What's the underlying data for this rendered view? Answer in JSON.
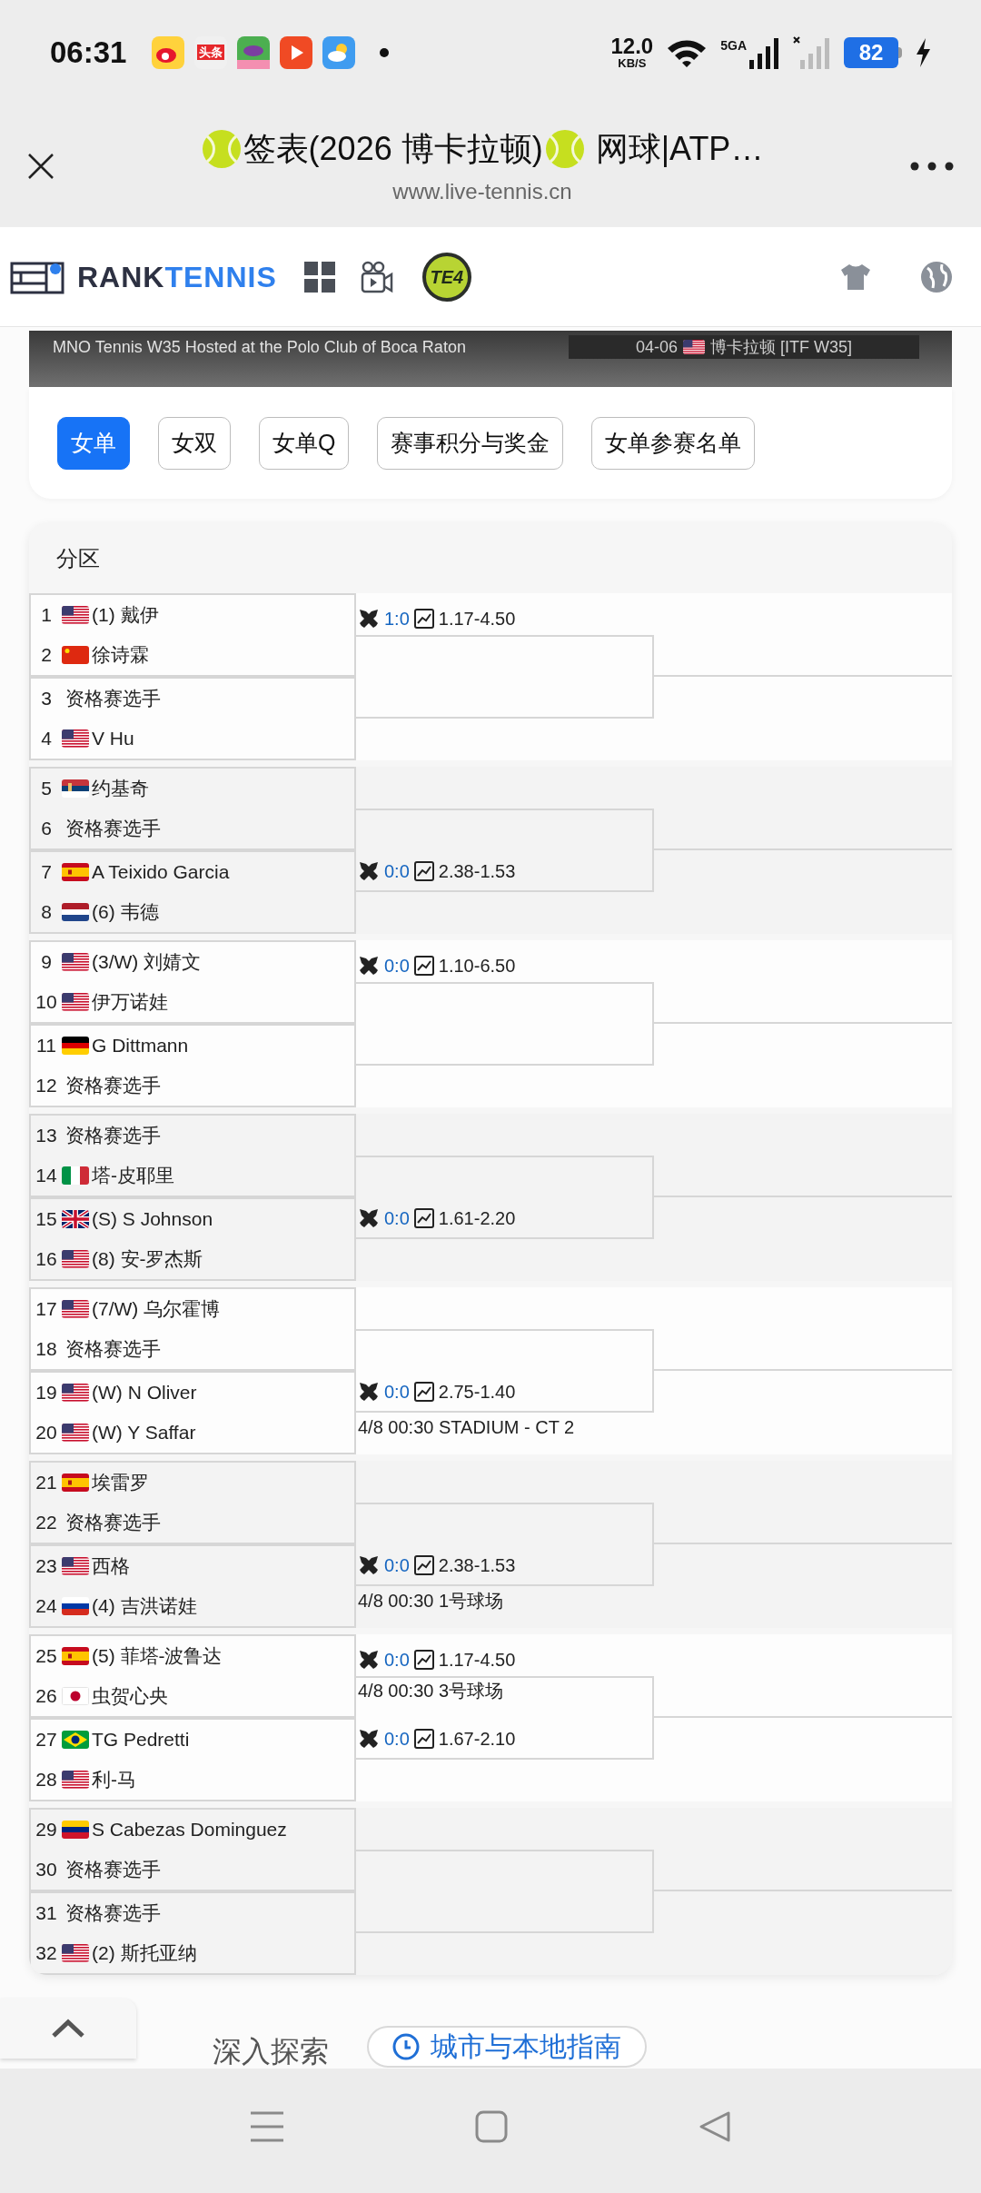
{
  "status_bar": {
    "time": "06:31",
    "notification_label": "头条",
    "net_speed": "12.0",
    "net_unit": "KB/S",
    "network": "5GA",
    "battery": "82"
  },
  "browser": {
    "title_parts": [
      "签表(2026 博卡拉顿)",
      "网球|ATP…"
    ],
    "url": "www.live-tennis.cn"
  },
  "site_header": {
    "logo_dark": "RANK",
    "logo_blue": "TENNIS",
    "badge": "TE4"
  },
  "banner": {
    "event": "MNO Tennis W35 Hosted at the Polo Club of Boca Raton",
    "date": "04-06",
    "flag": {
      "kind": "us"
    },
    "location": "博卡拉顿 [ITF W35]"
  },
  "tabs": [
    {
      "label": "女单",
      "selected": true
    },
    {
      "label": "女双",
      "selected": false
    },
    {
      "label": "女单Q",
      "selected": false
    },
    {
      "label": "赛事积分与奖金",
      "selected": false
    },
    {
      "label": "女单参赛名单",
      "selected": false
    }
  ],
  "draw": {
    "heading": "分区",
    "groups": [
      {
        "players": [
          {
            "no": "1",
            "flag": {
              "kind": "us"
            },
            "name": "(1) 戴伊"
          },
          {
            "no": "2",
            "flag": {
              "kind": "cn"
            },
            "name": "徐诗霖"
          },
          {
            "no": "3",
            "name": "资格赛选手"
          },
          {
            "no": "4",
            "flag": {
              "kind": "us"
            },
            "name": "V Hu"
          }
        ],
        "matches": [
          {
            "kind": "top",
            "score": "1:0",
            "odds": "1.17-4.50"
          }
        ]
      },
      {
        "players": [
          {
            "no": "5",
            "flag": {
              "kind": "rs"
            },
            "name": "约基奇"
          },
          {
            "no": "6",
            "name": "资格赛选手"
          },
          {
            "no": "7",
            "flag": {
              "kind": "es"
            },
            "name": "A Teixido Garcia"
          },
          {
            "no": "8",
            "flag": {
              "kind": "nl"
            },
            "name": "(6) 韦德"
          }
        ],
        "matches": [
          {
            "kind": "bottom",
            "score": "0:0",
            "odds": "2.38-1.53"
          }
        ]
      },
      {
        "players": [
          {
            "no": "9",
            "flag": {
              "kind": "us"
            },
            "name": "(3/W) 刘婧文"
          },
          {
            "no": "10",
            "flag": {
              "kind": "us"
            },
            "name": "伊万诺娃"
          },
          {
            "no": "11",
            "flag": {
              "kind": "de"
            },
            "name": "G Dittmann"
          },
          {
            "no": "12",
            "name": "资格赛选手"
          }
        ],
        "matches": [
          {
            "kind": "top",
            "score": "0:0",
            "odds": "1.10-6.50"
          }
        ]
      },
      {
        "players": [
          {
            "no": "13",
            "name": "资格赛选手"
          },
          {
            "no": "14",
            "flag": {
              "kind": "it"
            },
            "name": "塔-皮耶里"
          },
          {
            "no": "15",
            "flag": {
              "kind": "gb"
            },
            "name": "(S) S Johnson"
          },
          {
            "no": "16",
            "flag": {
              "kind": "us"
            },
            "name": "(8) 安-罗杰斯"
          }
        ],
        "matches": [
          {
            "kind": "bottom",
            "score": "0:0",
            "odds": "1.61-2.20"
          }
        ]
      },
      {
        "players": [
          {
            "no": "17",
            "flag": {
              "kind": "us"
            },
            "name": "(7/W) 乌尔霍博"
          },
          {
            "no": "18",
            "name": "资格赛选手"
          },
          {
            "no": "19",
            "flag": {
              "kind": "us"
            },
            "name": "(W) N Oliver"
          },
          {
            "no": "20",
            "flag": {
              "kind": "us"
            },
            "name": "(W) Y Saffar"
          }
        ],
        "matches": [
          {
            "kind": "bottom",
            "score": "0:0",
            "odds": "2.75-1.40",
            "schedule": "4/8 00:30 STADIUM - CT 2"
          }
        ]
      },
      {
        "players": [
          {
            "no": "21",
            "flag": {
              "kind": "es"
            },
            "name": "埃雷罗"
          },
          {
            "no": "22",
            "name": "资格赛选手"
          },
          {
            "no": "23",
            "flag": {
              "kind": "us"
            },
            "name": "西格"
          },
          {
            "no": "24",
            "flag": {
              "kind": "ru"
            },
            "name": "(4) 吉洪诺娃"
          }
        ],
        "matches": [
          {
            "kind": "bottom",
            "score": "0:0",
            "odds": "2.38-1.53",
            "schedule": "4/8 00:30 1号球场"
          }
        ]
      },
      {
        "players": [
          {
            "no": "25",
            "flag": {
              "kind": "es"
            },
            "name": "(5) 菲塔-波鲁达"
          },
          {
            "no": "26",
            "flag": {
              "kind": "jp"
            },
            "name": "虫贺心央"
          },
          {
            "no": "27",
            "flag": {
              "kind": "br"
            },
            "name": "TG Pedretti"
          },
          {
            "no": "28",
            "flag": {
              "kind": "us"
            },
            "name": "利-马"
          }
        ],
        "matches": [
          {
            "kind": "top",
            "score": "0:0",
            "odds": "1.17-4.50",
            "schedule": "4/8 00:30 3号球场"
          },
          {
            "kind": "bottom",
            "score": "0:0",
            "odds": "1.67-2.10"
          }
        ]
      },
      {
        "players": [
          {
            "no": "29",
            "flag": {
              "kind": "ve"
            },
            "name": "S Cabezas Dominguez"
          },
          {
            "no": "30",
            "name": "资格赛选手"
          },
          {
            "no": "31",
            "name": "资格赛选手"
          },
          {
            "no": "32",
            "flag": {
              "kind": "us"
            },
            "name": "(2) 斯托亚纳"
          }
        ]
      }
    ]
  },
  "footer": {
    "section": "深入探索",
    "link": "城市与本地指南"
  }
}
